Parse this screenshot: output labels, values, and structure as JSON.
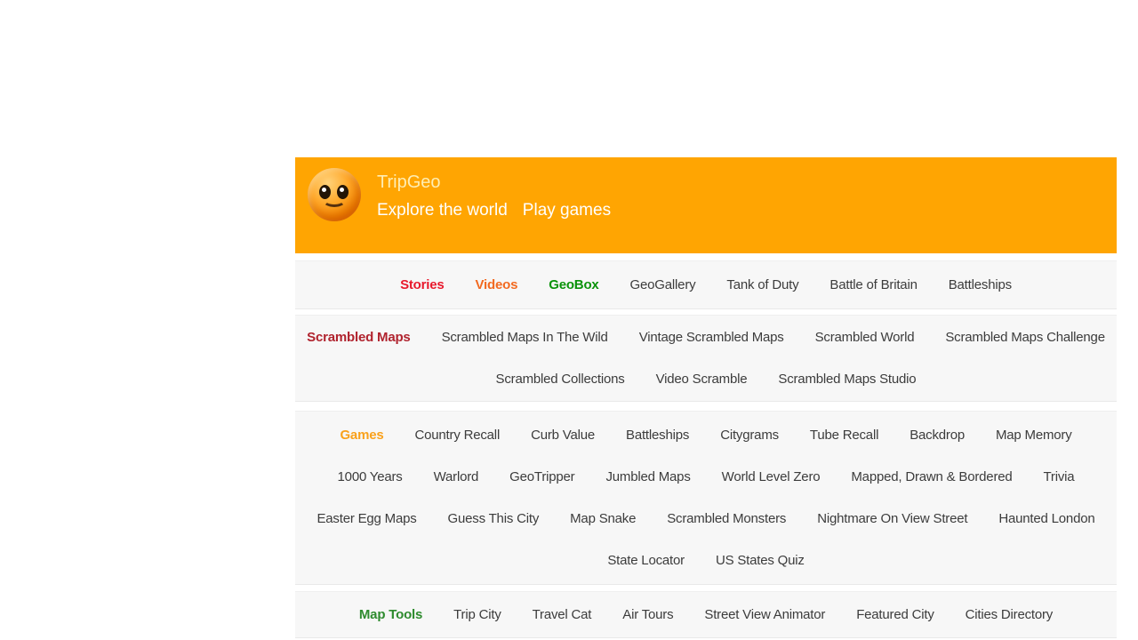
{
  "header": {
    "title": "TripGeo",
    "tagline_links": [
      "Explore the world",
      "Play games"
    ],
    "logo_icon": "smiling-face-emoji",
    "bg_color": "#FFA502",
    "title_color": "#FFEDB3",
    "tagline_color": "#FFFFFF"
  },
  "nav": {
    "bar_bg": "#F7F7F7",
    "link_color": "#3C3C3C",
    "sections": [
      {
        "name": "main",
        "rows": [
          [
            {
              "label": "Stories",
              "color": "#E8192C",
              "bold": true
            },
            {
              "label": "Videos",
              "color": "#F26A21",
              "bold": true
            },
            {
              "label": "GeoBox",
              "color": "#0A930A",
              "bold": true
            },
            {
              "label": "GeoGallery"
            },
            {
              "label": "Tank of Duty"
            },
            {
              "label": "Battle of Britain"
            },
            {
              "label": "Battleships"
            }
          ]
        ]
      },
      {
        "name": "scrambled-maps",
        "rows": [
          [
            {
              "label": "Scrambled Maps",
              "color": "#B0232E",
              "bold": true
            },
            {
              "label": "Scrambled Maps In The Wild"
            },
            {
              "label": "Vintage Scrambled Maps"
            },
            {
              "label": "Scrambled World"
            },
            {
              "label": "Scrambled Maps Challenge"
            }
          ],
          [
            {
              "label": "Scrambled Collections"
            },
            {
              "label": "Video Scramble"
            },
            {
              "label": "Scrambled Maps Studio"
            }
          ]
        ]
      },
      {
        "name": "games",
        "rows": [
          [
            {
              "label": "Games",
              "color": "#F9A11B",
              "bold": true
            },
            {
              "label": "Country Recall"
            },
            {
              "label": "Curb Value"
            },
            {
              "label": "Battleships"
            },
            {
              "label": "Citygrams"
            },
            {
              "label": "Tube Recall"
            },
            {
              "label": "Backdrop"
            },
            {
              "label": "Map Memory"
            }
          ],
          [
            {
              "label": "1000 Years"
            },
            {
              "label": "Warlord"
            },
            {
              "label": "GeoTripper"
            },
            {
              "label": "Jumbled Maps"
            },
            {
              "label": "World Level Zero"
            },
            {
              "label": "Mapped, Drawn & Bordered"
            },
            {
              "label": "Trivia"
            }
          ],
          [
            {
              "label": "Easter Egg Maps"
            },
            {
              "label": "Guess This City"
            },
            {
              "label": "Map Snake"
            },
            {
              "label": "Scrambled Monsters"
            },
            {
              "label": "Nightmare On View Street"
            },
            {
              "label": "Haunted London"
            }
          ],
          [
            {
              "label": "State Locator"
            },
            {
              "label": "US States Quiz"
            }
          ]
        ]
      },
      {
        "name": "map-tools",
        "rows": [
          [
            {
              "label": "Map Tools",
              "color": "#2E8B2E",
              "bold": true
            },
            {
              "label": "Trip City"
            },
            {
              "label": "Travel Cat"
            },
            {
              "label": "Air Tours"
            },
            {
              "label": "Street View Animator"
            },
            {
              "label": "Featured City"
            },
            {
              "label": "Cities Directory"
            }
          ]
        ]
      }
    ]
  }
}
